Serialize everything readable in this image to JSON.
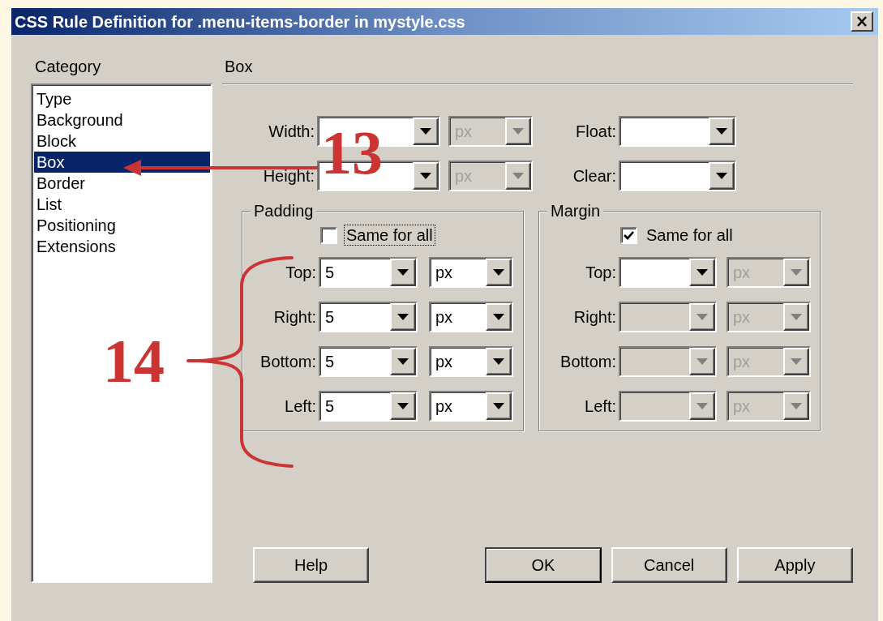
{
  "window": {
    "title": "CSS Rule Definition for .menu-items-border in mystyle.css"
  },
  "category": {
    "label": "Category",
    "items": [
      {
        "label": "Type",
        "selected": false
      },
      {
        "label": "Background",
        "selected": false
      },
      {
        "label": "Block",
        "selected": false
      },
      {
        "label": "Box",
        "selected": true
      },
      {
        "label": "Border",
        "selected": false
      },
      {
        "label": "List",
        "selected": false
      },
      {
        "label": "Positioning",
        "selected": false
      },
      {
        "label": "Extensions",
        "selected": false
      }
    ]
  },
  "panel": {
    "title": "Box"
  },
  "size_fields": [
    {
      "label": "Width:",
      "unit": "px",
      "unit_enabled": false
    },
    {
      "label": "Height:",
      "unit": "px",
      "unit_enabled": false
    }
  ],
  "float_fields": [
    {
      "label": "Float:"
    },
    {
      "label": "Clear:"
    }
  ],
  "padding": {
    "title": "Padding",
    "same_for_all": {
      "label": "Same for all",
      "checked": false,
      "focused": true
    },
    "rows": [
      {
        "label": "Top:",
        "value": "5",
        "unit": "px",
        "enabled": true,
        "unit_enabled": true
      },
      {
        "label": "Right:",
        "value": "5",
        "unit": "px",
        "enabled": true,
        "unit_enabled": true
      },
      {
        "label": "Bottom:",
        "value": "5",
        "unit": "px",
        "enabled": true,
        "unit_enabled": true
      },
      {
        "label": "Left:",
        "value": "5",
        "unit": "px",
        "enabled": true,
        "unit_enabled": true
      }
    ]
  },
  "margin": {
    "title": "Margin",
    "same_for_all": {
      "label": "Same for all",
      "checked": true,
      "focused": false
    },
    "rows": [
      {
        "label": "Top:",
        "unit": "px",
        "enabled": true,
        "unit_enabled": false
      },
      {
        "label": "Right:",
        "unit": "px",
        "enabled": false,
        "unit_enabled": false
      },
      {
        "label": "Bottom:",
        "unit": "px",
        "enabled": false,
        "unit_enabled": false
      },
      {
        "label": "Left:",
        "unit": "px",
        "enabled": false,
        "unit_enabled": false
      }
    ]
  },
  "buttons": [
    {
      "label": "Help",
      "default": false
    },
    {
      "label": "OK",
      "default": true
    },
    {
      "label": "Cancel",
      "default": false
    },
    {
      "label": "Apply",
      "default": false
    }
  ],
  "annotations": [
    {
      "label": "13"
    },
    {
      "label": "14"
    }
  ]
}
